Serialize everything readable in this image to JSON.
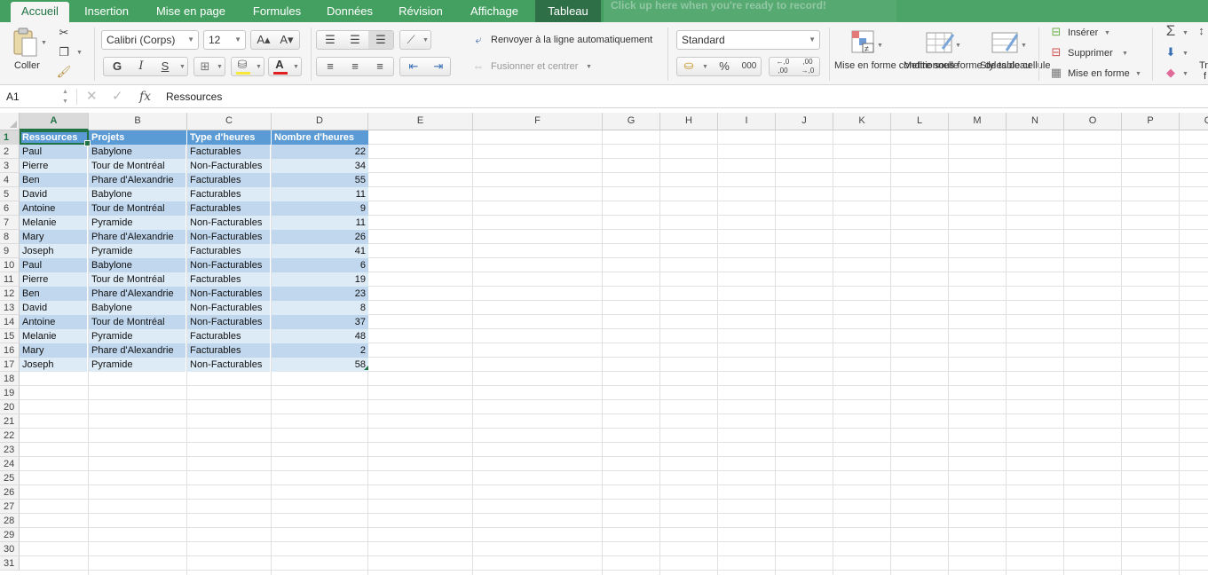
{
  "tabs": [
    {
      "label": "Accueil",
      "active": true
    },
    {
      "label": "Insertion"
    },
    {
      "label": "Mise en page"
    },
    {
      "label": "Formules"
    },
    {
      "label": "Données"
    },
    {
      "label": "Révision"
    },
    {
      "label": "Affichage"
    },
    {
      "label": "Tableau",
      "contextual": true
    }
  ],
  "banner": {
    "text": "Click up here when you're ready to record!"
  },
  "ribbon": {
    "paste_label": "Coller",
    "font_name": "Calibri (Corps)",
    "font_size": "12",
    "bold": "G",
    "italic": "I",
    "underline": "S",
    "wrap_text": "Renvoyer à la ligne automatiquement",
    "merge_center": "Fusionner et centrer",
    "number_format": "Standard",
    "percent": "%",
    "thousands": "000",
    "cond_format": "Mise en forme conditionnelle",
    "format_table": "Mettre sous forme de tableau",
    "cell_styles": "Styles de cellule",
    "insert": "Insérer",
    "delete": "Supprimer",
    "format": "Mise en forme",
    "sort_partial": "Tr",
    "sort_partial2": "f"
  },
  "formula_bar": {
    "cell_ref": "A1",
    "fx": "fx",
    "value": "Ressources"
  },
  "columns": [
    "A",
    "B",
    "C",
    "D",
    "E",
    "F",
    "G",
    "H",
    "I",
    "J",
    "K",
    "L",
    "M",
    "N",
    "O",
    "P",
    "Q"
  ],
  "row_numbers": [
    "1",
    "2",
    "3",
    "4",
    "5",
    "6",
    "7",
    "8",
    "9",
    "10",
    "11",
    "12",
    "13",
    "14",
    "15",
    "16",
    "17",
    "18",
    "19",
    "20",
    "21",
    "22",
    "23",
    "24",
    "25",
    "26",
    "27",
    "28",
    "29",
    "30",
    "31"
  ],
  "table": {
    "headers": [
      "Ressources",
      "Projets",
      "Type d'heures",
      "Nombre d'heures"
    ],
    "rows": [
      [
        "Paul",
        "Babylone",
        "Facturables",
        "22"
      ],
      [
        "Pierre",
        "Tour de Montréal",
        "Non-Facturables",
        "34"
      ],
      [
        "Ben",
        "Phare d'Alexandrie",
        "Facturables",
        "55"
      ],
      [
        "David",
        "Babylone",
        "Facturables",
        "11"
      ],
      [
        "Antoine",
        "Tour de Montréal",
        "Facturables",
        "9"
      ],
      [
        "Melanie",
        "Pyramide",
        "Non-Facturables",
        "11"
      ],
      [
        "Mary",
        "Phare d'Alexandrie",
        "Non-Facturables",
        "26"
      ],
      [
        "Joseph",
        "Pyramide",
        "Facturables",
        "41"
      ],
      [
        "Paul",
        "Babylone",
        "Non-Facturables",
        "6"
      ],
      [
        "Pierre",
        "Tour de Montréal",
        "Facturables",
        "19"
      ],
      [
        "Ben",
        "Phare d'Alexandrie",
        "Non-Facturables",
        "23"
      ],
      [
        "David",
        "Babylone",
        "Non-Facturables",
        "8"
      ],
      [
        "Antoine",
        "Tour de Montréal",
        "Non-Facturables",
        "37"
      ],
      [
        "Melanie",
        "Pyramide",
        "Facturables",
        "48"
      ],
      [
        "Mary",
        "Phare d'Alexandrie",
        "Facturables",
        "2"
      ],
      [
        "Joseph",
        "Pyramide",
        "Non-Facturables",
        "58"
      ]
    ]
  },
  "colors": {
    "ribbon_green": "#43a061",
    "table_header": "#5b9bd5",
    "band_dark": "#c0d7ee",
    "band_light": "#ddebf7",
    "selection": "#217346"
  }
}
